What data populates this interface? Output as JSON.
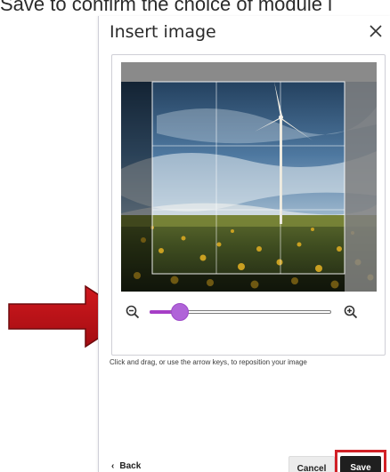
{
  "top_caption": "Save to confirm the choice of module i",
  "dialog": {
    "title": "Insert image",
    "close_icon": "close-icon",
    "help_text": "Click and drag, or use the arrow keys, to reposition your image",
    "zoom": {
      "zoom_out_icon": "zoom-out-icon",
      "zoom_in_icon": "zoom-in-icon",
      "level_fraction": 0.12
    },
    "footer": {
      "back_label": "Back",
      "cancel_label": "Cancel",
      "save_label": "Save"
    }
  },
  "colors": {
    "accent": "#a63ec6",
    "annotation_red": "#d12127",
    "save_bg": "#1f1f1f"
  }
}
